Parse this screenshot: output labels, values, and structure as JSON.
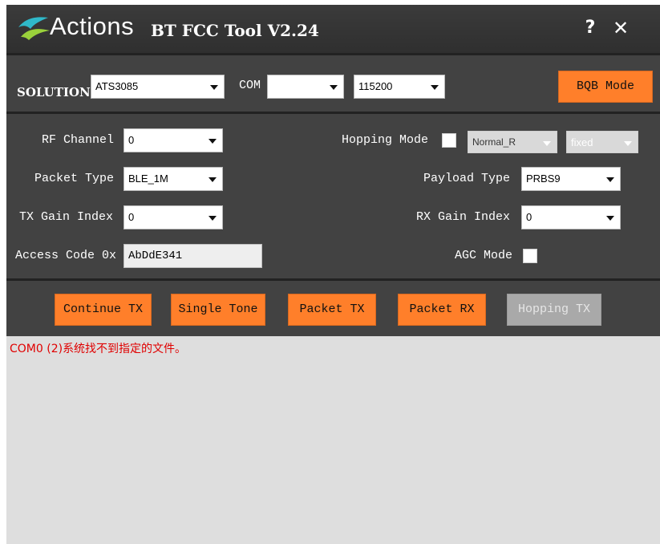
{
  "titlebar": {
    "brand": "Actions",
    "title": "BT FCC Tool V2.24",
    "help_glyph": "?",
    "close_glyph": "✕"
  },
  "solution_bar": {
    "solution_label": "SOLUTION",
    "solution_value": "ATS3085",
    "com_label": "COM",
    "com_value": "",
    "baud_value": "115200",
    "bqb_button": "BQB Mode"
  },
  "settings": {
    "rf_channel_label": "RF Channel",
    "rf_channel_value": "0",
    "hopping_mode_label": "Hopping Mode",
    "hopping_mode_checked": false,
    "hopping_pattern_value": "Normal_R",
    "hopping_type_value": "fixed",
    "packet_type_label": "Packet Type",
    "packet_type_value": "BLE_1M",
    "payload_type_label": "Payload Type",
    "payload_type_value": "PRBS9",
    "tx_gain_label": "TX Gain Index",
    "tx_gain_value": "0",
    "rx_gain_label": "RX Gain Index",
    "rx_gain_value": "0",
    "access_code_label": "Access Code 0x",
    "access_code_value": "AbDdE341",
    "agc_mode_label": "AGC Mode",
    "agc_mode_checked": false
  },
  "actions": {
    "continue_tx": "Continue TX",
    "single_tone": "Single Tone",
    "packet_tx": "Packet TX",
    "packet_rx": "Packet RX",
    "hopping_tx": "Hopping TX"
  },
  "log": {
    "lines": [
      "COM0 (2)系统找不到指定的文件。"
    ]
  },
  "colors": {
    "accent_button": "#ff7f2a",
    "panel_bg": "#424242",
    "log_error": "#e00000"
  }
}
